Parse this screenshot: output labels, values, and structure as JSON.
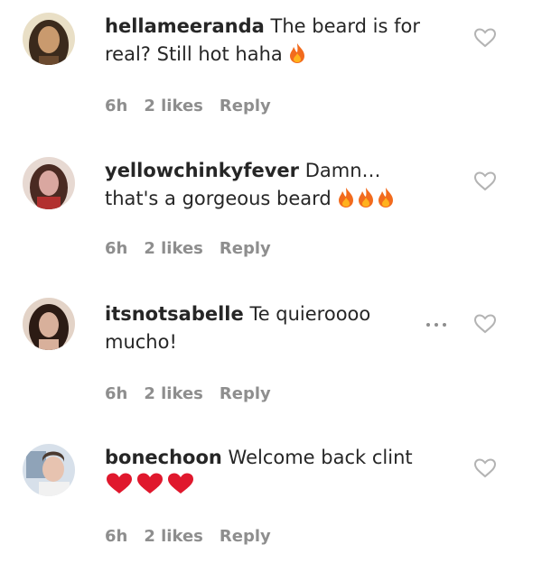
{
  "comments": [
    {
      "username": "hellameeranda",
      "text": "The beard is for real? Still hot haha",
      "emoji": [
        "fire"
      ],
      "age": "6h",
      "likes": "2 likes",
      "reply": "Reply",
      "avatar_colors": [
        "#3b2a1c",
        "#c99a6e"
      ]
    },
    {
      "username": "yellowchinkyfever",
      "text": "Damn… that's a gorgeous beard",
      "emoji": [
        "fire",
        "fire",
        "fire"
      ],
      "age": "6h",
      "likes": "2 likes",
      "reply": "Reply",
      "avatar_colors": [
        "#b2302f",
        "#d9a7a0"
      ]
    },
    {
      "username": "itsnotsabelle",
      "text": "Te quieroooo mucho!",
      "emoji": [],
      "age": "6h",
      "likes": "2 likes",
      "reply": "Reply",
      "avatar_colors": [
        "#2c1b14",
        "#d8b09b"
      ]
    },
    {
      "username": "bonechoon",
      "text": "Welcome back clint",
      "emoji": [
        "red-heart",
        "red-heart",
        "red-heart"
      ],
      "age": "6h",
      "likes": "2 likes",
      "reply": "Reply",
      "avatar_colors": [
        "#8fa3b8",
        "#e7c3b0"
      ]
    }
  ],
  "icons": {
    "like": "heart-outline-icon",
    "more": "more-options-icon",
    "fire": "fire-emoji",
    "red_heart": "red-heart-emoji"
  },
  "colors": {
    "text": "#262626",
    "meta": "#8e8e8e",
    "fire": "#f26b1d",
    "heart": "#e0182d"
  }
}
